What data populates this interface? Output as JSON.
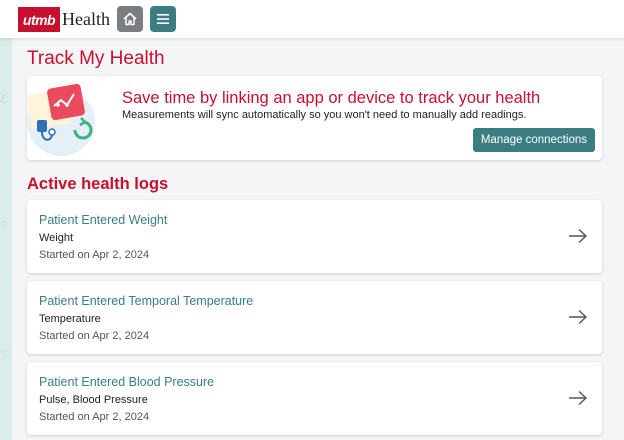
{
  "header": {
    "logo_mark": "utmb",
    "logo_text": "Health",
    "home_icon": "home-icon",
    "menu_icon": "hamburger-menu-icon"
  },
  "page": {
    "title": "Track My Health"
  },
  "link_card": {
    "title": "Save time by linking an app or device to track your health",
    "subtitle": "Measurements will sync automatically so you won't need to manually add readings.",
    "button_label": "Manage connections",
    "illustration_icon": "health-devices-illustration"
  },
  "logs": {
    "section_title": "Active health logs",
    "items": [
      {
        "name": "Patient Entered Weight",
        "type": "Weight",
        "started": "Started on Apr 2, 2024"
      },
      {
        "name": "Patient Entered Temporal Temperature",
        "type": "Temperature",
        "started": "Started on Apr 2, 2024"
      },
      {
        "name": "Patient Entered Blood Pressure",
        "type": "Pulse, Blood Pressure",
        "started": "Started on Apr 2, 2024"
      }
    ]
  },
  "colors": {
    "brand_red": "#c8102e",
    "teal": "#3c7d82",
    "home_button_gray": "#7a7e81"
  }
}
